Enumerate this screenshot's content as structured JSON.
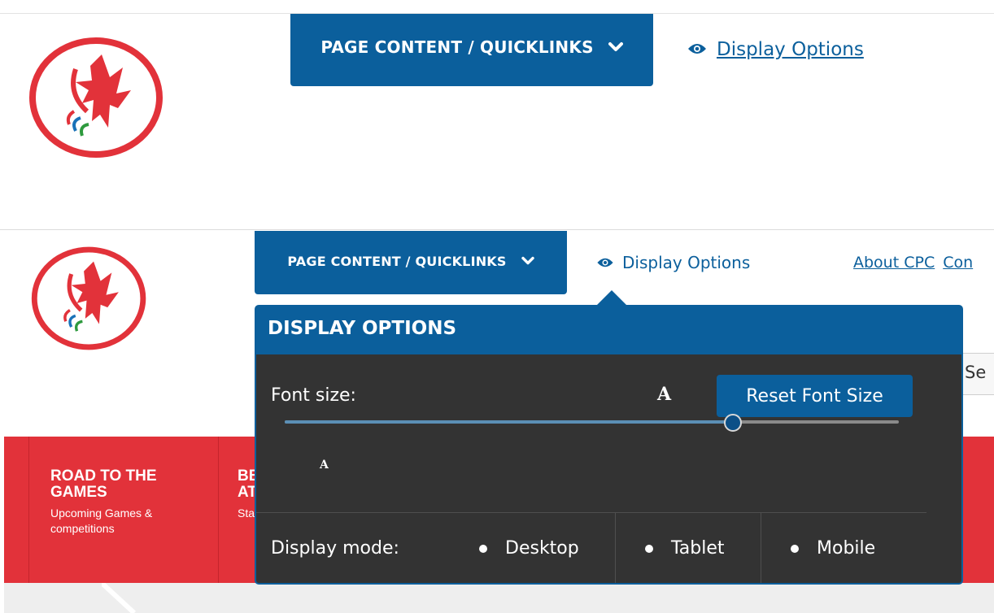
{
  "header": {
    "quicklinks_label": "PAGE CONTENT / QUICKLINKS",
    "display_options_label": "Display Options",
    "about_label": "About CPC",
    "contact_label": "Con"
  },
  "search": {
    "partial_label": "Se"
  },
  "nav": {
    "items": [
      {
        "title": "ROAD TO THE GAMES",
        "subtitle": "Upcoming Games & competitions"
      },
      {
        "title": "BE AT",
        "subtitle": "Sta"
      }
    ]
  },
  "display_panel": {
    "title": "DISPLAY OPTIONS",
    "font_size_label": "Font size:",
    "large_font_glyph": "A",
    "small_font_glyph": "A",
    "reset_label": "Reset Font Size",
    "font_slider_value": 0.73,
    "display_mode_label": "Display mode:",
    "modes": [
      "Desktop",
      "Tablet",
      "Mobile"
    ]
  },
  "colors": {
    "brand_blue": "#0b5f9c",
    "brand_red": "#e2323a",
    "panel_bg": "#333333"
  },
  "icons": [
    "maple-leaf-logo-icon",
    "chevron-down-icon",
    "eye-icon"
  ]
}
